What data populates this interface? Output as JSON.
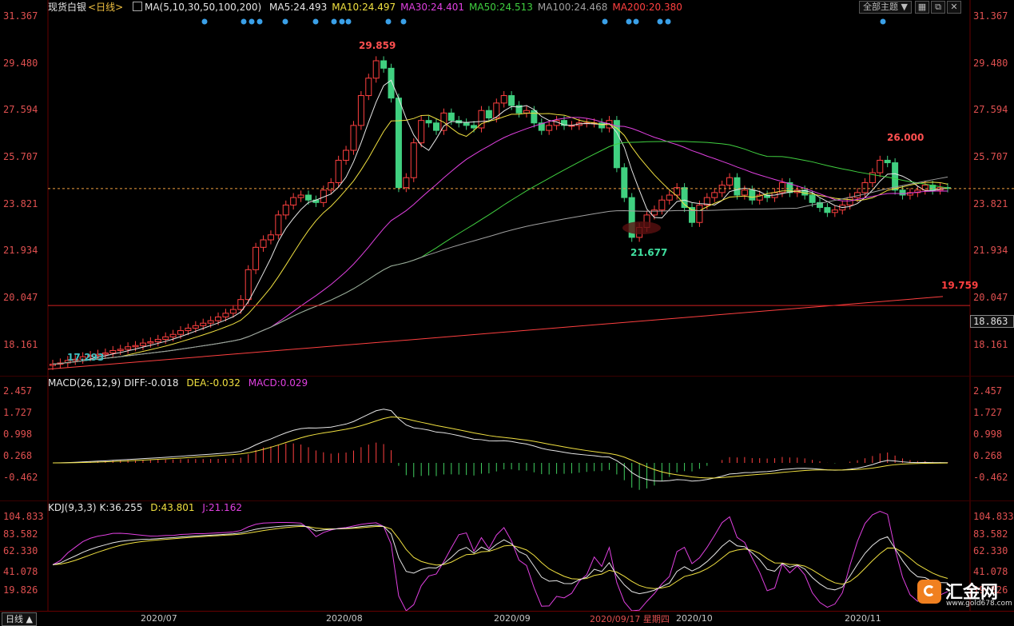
{
  "header": {
    "instrument": "现货白银",
    "period": "<日线>",
    "ma_label": "MA(5,10,30,50,100,200)",
    "ma_values": [
      {
        "text": "MA5:24.493",
        "color": "#e6e6e6"
      },
      {
        "text": "MA10:24.497",
        "color": "#f0e040"
      },
      {
        "text": "MA30:24.401",
        "color": "#e040e0"
      },
      {
        "text": "MA50:24.513",
        "color": "#40d040"
      },
      {
        "text": "MA100:24.468",
        "color": "#a0a0a0"
      },
      {
        "text": "MA200:20.380",
        "color": "#ff4040"
      }
    ],
    "theme_button": "全部主题 ▼",
    "icon_buttons": [
      "grid-icon",
      "expand-icon",
      "close-icon"
    ]
  },
  "price_axis": {
    "ticks": [
      "31.367",
      "29.480",
      "27.594",
      "25.707",
      "23.821",
      "21.934",
      "20.047",
      "18.161"
    ],
    "current_price": "18.863"
  },
  "annotations": {
    "high": "29.859",
    "low": "21.677",
    "start_low": "17.293",
    "recent_high": "26.000",
    "ma200_label": "19.759"
  },
  "macd": {
    "label": "MACD(26,12,9)",
    "diff": "DIFF:-0.018",
    "dea": "DEA:-0.032",
    "macd": "MACD:0.029",
    "ticks": [
      "2.457",
      "1.727",
      "0.998",
      "0.268",
      "-0.462"
    ]
  },
  "kdj": {
    "label": "KDJ(9,3,3)",
    "k": "K:36.255",
    "d": "D:43.801",
    "j": "J:21.162",
    "ticks": [
      "104.833",
      "83.582",
      "62.330",
      "41.078",
      "19.826"
    ]
  },
  "x_axis": {
    "period_button": "日线 ▲",
    "labels": [
      "2020/07",
      "2020/08",
      "2020/09",
      "2020/10",
      "2020/11"
    ],
    "cursor_label": "2020/09/17 星期四"
  },
  "watermark": {
    "name": "汇金网",
    "url": "www.gold678.com"
  },
  "chart_data": {
    "type": "candlestick",
    "title": "现货白银 <日线>",
    "ylim": [
      17.0,
      31.4
    ],
    "closes": [
      17.4,
      17.45,
      17.55,
      17.6,
      17.7,
      17.75,
      17.8,
      17.85,
      17.95,
      18.0,
      18.1,
      18.15,
      18.25,
      18.3,
      18.4,
      18.5,
      18.6,
      18.75,
      18.85,
      18.95,
      19.05,
      19.15,
      19.3,
      19.45,
      19.6,
      20.0,
      21.2,
      22.1,
      22.4,
      22.6,
      23.4,
      23.8,
      24.1,
      24.2,
      24.0,
      23.9,
      24.4,
      24.7,
      25.6,
      26.0,
      27.0,
      28.2,
      28.9,
      29.6,
      29.3,
      28.1,
      24.5,
      24.9,
      26.3,
      27.2,
      27.1,
      26.8,
      27.5,
      27.2,
      27.1,
      27.0,
      26.9,
      27.6,
      27.3,
      27.9,
      28.2,
      27.8,
      27.5,
      27.6,
      27.1,
      26.8,
      27.0,
      27.2,
      27.0,
      27.0,
      27.1,
      27.1,
      27.1,
      26.9,
      27.2,
      25.3,
      24.1,
      22.5,
      22.9,
      23.4,
      23.6,
      24.0,
      24.2,
      24.5,
      23.7,
      23.1,
      23.8,
      24.1,
      24.3,
      24.6,
      24.9,
      24.2,
      24.4,
      24.0,
      24.2,
      24.1,
      24.3,
      24.7,
      24.3,
      24.4,
      24.2,
      23.9,
      23.7,
      23.5,
      23.6,
      23.8,
      24.1,
      24.3,
      24.7,
      25.1,
      25.6,
      25.5,
      24.4,
      24.2,
      24.3,
      24.4,
      24.6,
      24.4,
      24.5,
      24.49
    ]
  }
}
